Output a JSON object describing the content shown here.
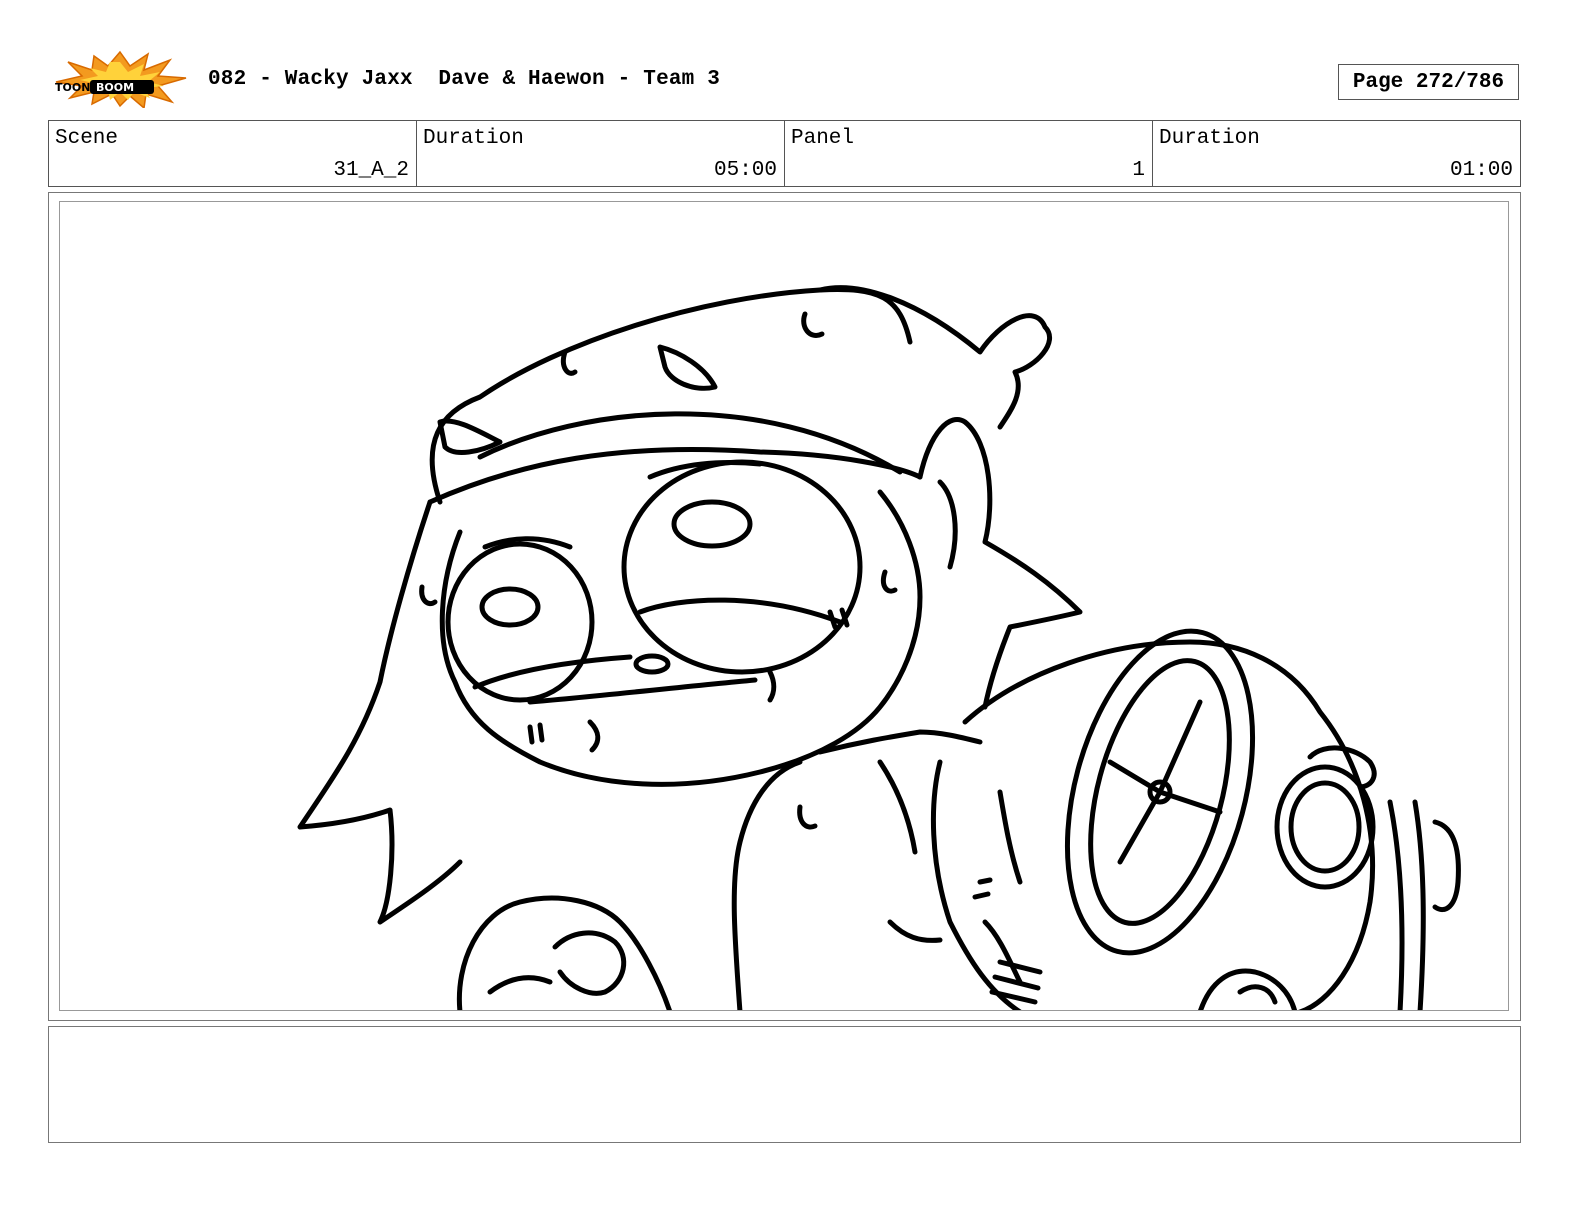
{
  "header": {
    "logo_text": "TOONBOOM",
    "title": "082 - Wacky Jaxx  Dave & Haewon - Team 3",
    "page_label": "Page 272/786"
  },
  "info": {
    "scene_label": "Scene",
    "scene_value": "31_A_2",
    "duration_label": "Duration",
    "duration_value": "05:00",
    "panel_label": "Panel",
    "panel_value": "1",
    "panel_duration_label": "Duration",
    "panel_duration_value": "01:00"
  },
  "panel": {
    "drawing": "character-with-fan-sketch"
  },
  "notes": {
    "text": ""
  }
}
